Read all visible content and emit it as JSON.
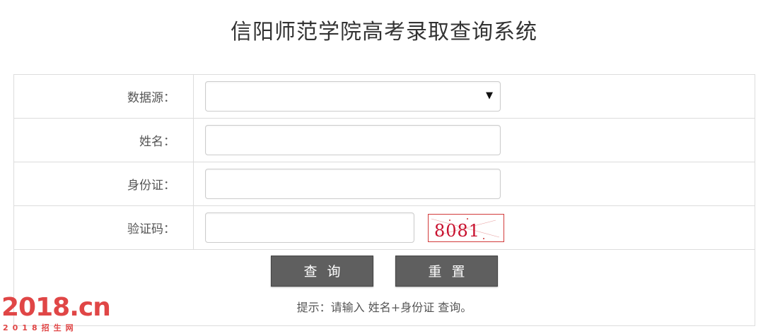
{
  "page": {
    "title": "信阳师范学院高考录取查询系统"
  },
  "form": {
    "data_source": {
      "label": "数据源：",
      "value": "",
      "chevron": "▼"
    },
    "name": {
      "label": "姓名：",
      "value": ""
    },
    "id_card": {
      "label": "身份证：",
      "value": ""
    },
    "captcha": {
      "label": "验证码：",
      "value": "",
      "image_text": "8081"
    }
  },
  "actions": {
    "query_label": "查询",
    "reset_label": "重置"
  },
  "hint": {
    "prefix": "提示：请输入",
    "fields": "姓名+身份证",
    "suffix": "查询。"
  },
  "watermark": {
    "main": "2018.cn",
    "sub": "2018招生网"
  },
  "colors": {
    "button_bg": "#5f5f5f",
    "captcha_accent": "#d23b3b",
    "watermark": "#e04646"
  }
}
